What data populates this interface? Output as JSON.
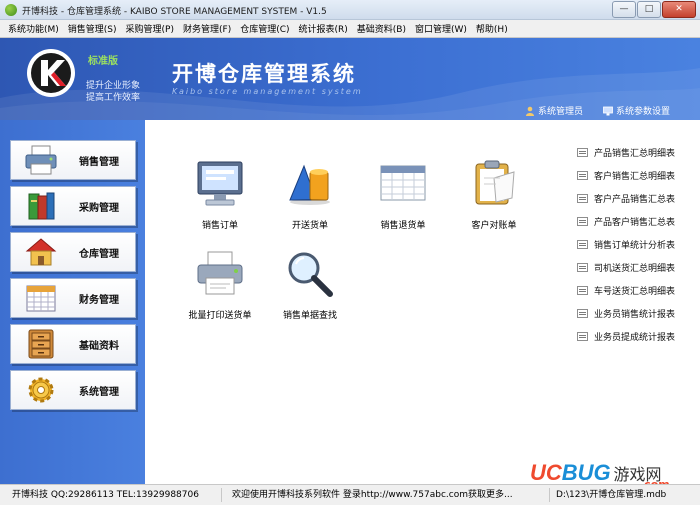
{
  "window": {
    "title": "开博科技 - 仓库管理系统 - KAIBO STORE MANAGEMENT SYSTEM - V1.5",
    "min_glyph": "—",
    "max_glyph": "□",
    "close_glyph": "✕"
  },
  "menu": [
    "系统功能(M)",
    "销售管理(S)",
    "采购管理(P)",
    "财务管理(F)",
    "仓库管理(C)",
    "统计报表(R)",
    "基础资料(B)",
    "窗口管理(W)",
    "帮助(H)"
  ],
  "header": {
    "edition": "标准版",
    "slogan_line1": "提升企业形象",
    "slogan_line2": "提高工作效率",
    "title": "开博仓库管理系统",
    "subtitle": "Kaibo store management system",
    "admin_link": "系统管理员",
    "settings_link": "系统参数设置"
  },
  "sidebar": [
    {
      "label": "销售管理",
      "icon": "printer-icon"
    },
    {
      "label": "采购管理",
      "icon": "books-icon"
    },
    {
      "label": "仓库管理",
      "icon": "house-icon"
    },
    {
      "label": "财务管理",
      "icon": "calendar-icon"
    },
    {
      "label": "基础资料",
      "icon": "cabinet-icon"
    },
    {
      "label": "系统管理",
      "icon": "gear-icon"
    }
  ],
  "tiles": [
    {
      "label": "销售订单",
      "icon": "monitor-icon"
    },
    {
      "label": "开送货单",
      "icon": "shapes-icon"
    },
    {
      "label": "销售退货单",
      "icon": "calendar-grid-icon"
    },
    {
      "label": "客户对账单",
      "icon": "clipboard-icon"
    },
    {
      "label": "批量打印送货单",
      "icon": "printer-icon"
    },
    {
      "label": "销售单据查找",
      "icon": "magnifier-icon"
    }
  ],
  "reports": [
    "产品销售汇总明细表",
    "客户销售汇总明细表",
    "客户产品销售汇总表",
    "产品客户销售汇总表",
    "销售订单统计分析表",
    "司机送货汇总明细表",
    "车号送货汇总明细表",
    "业务员销售统计报表",
    "业务员提成统计报表"
  ],
  "watermark": {
    "uc": "UC",
    "bug": "BUG",
    "cn": "游戏网",
    "com": ".com"
  },
  "status": {
    "company": "开博科技 QQ:29286113 TEL:13929988706",
    "welcome": "欢迎使用开博科技系列软件  登录http://www.757abc.com获取更多...",
    "path": "D:\\123\\开博仓库管理.mdb"
  },
  "colors": {
    "header_blue": "#3c6fd2",
    "accent_green": "#9be060"
  }
}
